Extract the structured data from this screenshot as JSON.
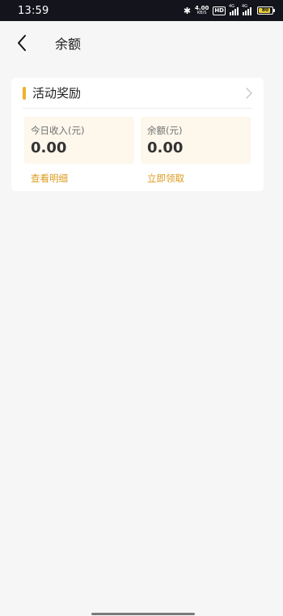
{
  "status_bar": {
    "time": "13:59",
    "bluetooth_icon": "bluetooth-icon",
    "speed_value": "4.00",
    "speed_unit": "KB/S",
    "hd_label": "HD",
    "sim1_net": "4G",
    "sim2_net": "4G",
    "battery_level": "80"
  },
  "nav": {
    "back_icon": "chevron-left-icon",
    "title": "余额"
  },
  "activity_card": {
    "title": "活动奖励",
    "accent_color": "#f0b12e",
    "today_income": {
      "label": "今日收入(元)",
      "value": "0.00",
      "link": "查看明细"
    },
    "balance": {
      "label": "余额(元)",
      "value": "0.00",
      "link": "立即领取"
    }
  }
}
